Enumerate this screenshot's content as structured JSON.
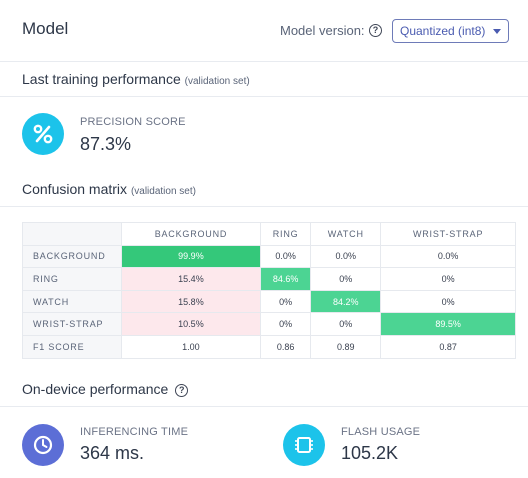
{
  "header": {
    "title": "Model",
    "model_version_label": "Model version:",
    "model_version_value": "Quantized (int8)"
  },
  "last_training": {
    "title": "Last training performance",
    "subtitle": "(validation set)",
    "precision": {
      "label": "PRECISION SCORE",
      "value": "87.3%",
      "icon": "percent-icon"
    }
  },
  "confusion": {
    "title": "Confusion matrix",
    "subtitle": "(validation set)",
    "columns": [
      "BACKGROUND",
      "RING",
      "WATCH",
      "WRIST-STRAP"
    ],
    "rows": [
      {
        "label": "BACKGROUND",
        "cells": [
          "99.9%",
          "0.0%",
          "0.0%",
          "0.0%"
        ]
      },
      {
        "label": "RING",
        "cells": [
          "15.4%",
          "84.6%",
          "0%",
          "0%"
        ]
      },
      {
        "label": "WATCH",
        "cells": [
          "15.8%",
          "0%",
          "84.2%",
          "0%"
        ]
      },
      {
        "label": "WRIST-STRAP",
        "cells": [
          "10.5%",
          "0%",
          "0%",
          "89.5%"
        ]
      }
    ],
    "f1": {
      "label": "F1 SCORE",
      "cells": [
        "1.00",
        "0.86",
        "0.89",
        "0.87"
      ]
    }
  },
  "on_device": {
    "title": "On-device performance",
    "inferencing": {
      "label": "INFERENCING TIME",
      "value": "364 ms.",
      "icon": "clock-icon"
    },
    "flash": {
      "label": "FLASH USAGE",
      "value": "105.2K",
      "icon": "chip-icon"
    }
  },
  "colors": {
    "accent_blue": "#4a5bb0",
    "cyan": "#1cc3ea",
    "indigo": "#5c6ed6",
    "green_strong": "#34c87a",
    "green": "#4cd493",
    "error_pink": "#fde8ec"
  }
}
